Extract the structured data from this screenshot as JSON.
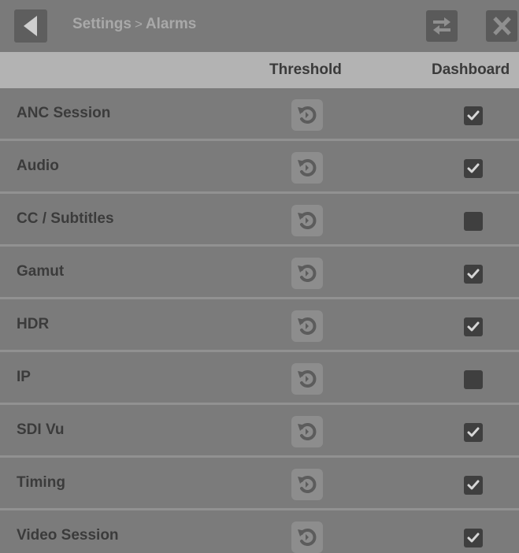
{
  "titlebar": {
    "breadcrumb_parent": "Settings",
    "breadcrumb_separator": ">",
    "breadcrumb_current": "Alarms",
    "icons": {
      "back": "back-arrow-icon",
      "swap": "swap-arrows-icon",
      "close": "close-icon"
    }
  },
  "table": {
    "headers": {
      "threshold": "Threshold",
      "dashboard": "Dashboard"
    },
    "rows": [
      {
        "label": "ANC Session",
        "dashboard": true
      },
      {
        "label": "Audio",
        "dashboard": true
      },
      {
        "label": "CC / Subtitles",
        "dashboard": false
      },
      {
        "label": "Gamut",
        "dashboard": true
      },
      {
        "label": "HDR",
        "dashboard": true
      },
      {
        "label": "IP",
        "dashboard": false
      },
      {
        "label": "SDI Vu",
        "dashboard": true
      },
      {
        "label": "Timing",
        "dashboard": true
      },
      {
        "label": "Video Session",
        "dashboard": true
      }
    ],
    "threshold_icon": "reset-icon",
    "dashboard_icon": "checkbox"
  }
}
